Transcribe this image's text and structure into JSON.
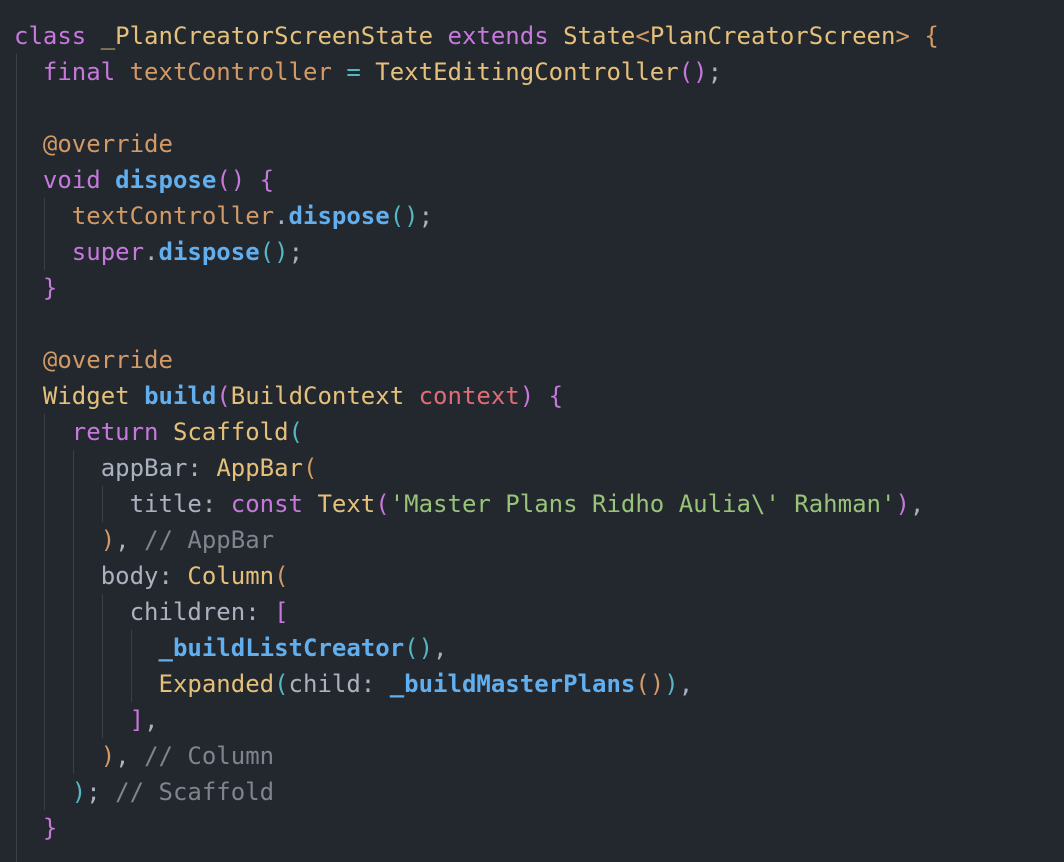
{
  "editor": {
    "lines": [
      [
        [
          "kw",
          "class"
        ],
        [
          "pl",
          " "
        ],
        [
          "cls",
          "_PlanCreatorScreenState"
        ],
        [
          "pl",
          " "
        ],
        [
          "kw",
          "extends"
        ],
        [
          "pl",
          " "
        ],
        [
          "cls",
          "State"
        ],
        [
          "p1",
          "<"
        ],
        [
          "cls",
          "PlanCreatorScreen"
        ],
        [
          "p1",
          ">"
        ],
        [
          "pl",
          " "
        ],
        [
          "p1",
          "{"
        ]
      ],
      [
        [
          "pl",
          "  "
        ],
        [
          "kw",
          "final"
        ],
        [
          "pl",
          " "
        ],
        [
          "var",
          "textController"
        ],
        [
          "pl",
          " "
        ],
        [
          "p3",
          "="
        ],
        [
          "pl",
          " "
        ],
        [
          "cls",
          "TextEditingController"
        ],
        [
          "p2",
          "("
        ],
        [
          "p2",
          ")"
        ],
        [
          "pl",
          ";"
        ]
      ],
      [],
      [
        [
          "pl",
          "  "
        ],
        [
          "ann",
          "@override"
        ]
      ],
      [
        [
          "pl",
          "  "
        ],
        [
          "kw",
          "void"
        ],
        [
          "pl",
          " "
        ],
        [
          "fn",
          "dispose"
        ],
        [
          "p2",
          "("
        ],
        [
          "p2",
          ")"
        ],
        [
          "pl",
          " "
        ],
        [
          "p2",
          "{"
        ]
      ],
      [
        [
          "pl",
          "    "
        ],
        [
          "var",
          "textController"
        ],
        [
          "pl",
          "."
        ],
        [
          "fn",
          "dispose"
        ],
        [
          "p3",
          "("
        ],
        [
          "p3",
          ")"
        ],
        [
          "pl",
          ";"
        ]
      ],
      [
        [
          "pl",
          "    "
        ],
        [
          "kw",
          "super"
        ],
        [
          "pl",
          "."
        ],
        [
          "fn",
          "dispose"
        ],
        [
          "p3",
          "("
        ],
        [
          "p3",
          ")"
        ],
        [
          "pl",
          ";"
        ]
      ],
      [
        [
          "pl",
          "  "
        ],
        [
          "p2",
          "}"
        ]
      ],
      [],
      [
        [
          "pl",
          "  "
        ],
        [
          "ann",
          "@override"
        ]
      ],
      [
        [
          "pl",
          "  "
        ],
        [
          "cls",
          "Widget"
        ],
        [
          "pl",
          " "
        ],
        [
          "fn",
          "build"
        ],
        [
          "p2",
          "("
        ],
        [
          "cls",
          "BuildContext"
        ],
        [
          "pl",
          " "
        ],
        [
          "param",
          "context"
        ],
        [
          "p2",
          ")"
        ],
        [
          "pl",
          " "
        ],
        [
          "p2",
          "{"
        ]
      ],
      [
        [
          "pl",
          "    "
        ],
        [
          "kw",
          "return"
        ],
        [
          "pl",
          " "
        ],
        [
          "cls",
          "Scaffold"
        ],
        [
          "p3",
          "("
        ]
      ],
      [
        [
          "pl",
          "      "
        ],
        [
          "prop",
          "appBar"
        ],
        [
          "pl",
          ": "
        ],
        [
          "cls",
          "AppBar"
        ],
        [
          "p1",
          "("
        ]
      ],
      [
        [
          "pl",
          "        "
        ],
        [
          "prop",
          "title"
        ],
        [
          "pl",
          ": "
        ],
        [
          "kw",
          "const"
        ],
        [
          "pl",
          " "
        ],
        [
          "cls",
          "Text"
        ],
        [
          "p2",
          "("
        ],
        [
          "str",
          "'Master Plans Ridho Aulia\\' Rahman'"
        ],
        [
          "p2",
          ")"
        ],
        [
          "pl",
          ","
        ]
      ],
      [
        [
          "pl",
          "      "
        ],
        [
          "p1",
          ")"
        ],
        [
          "pl",
          ", "
        ],
        [
          "cmt",
          "// AppBar"
        ]
      ],
      [
        [
          "pl",
          "      "
        ],
        [
          "prop",
          "body"
        ],
        [
          "pl",
          ": "
        ],
        [
          "cls",
          "Column"
        ],
        [
          "p1",
          "("
        ]
      ],
      [
        [
          "pl",
          "        "
        ],
        [
          "prop",
          "children"
        ],
        [
          "pl",
          ": "
        ],
        [
          "p2",
          "["
        ]
      ],
      [
        [
          "pl",
          "          "
        ],
        [
          "fn",
          "_buildListCreator"
        ],
        [
          "p3",
          "("
        ],
        [
          "p3",
          ")"
        ],
        [
          "pl",
          ","
        ]
      ],
      [
        [
          "pl",
          "          "
        ],
        [
          "cls",
          "Expanded"
        ],
        [
          "p3",
          "("
        ],
        [
          "prop",
          "child"
        ],
        [
          "pl",
          ": "
        ],
        [
          "fn",
          "_buildMasterPlans"
        ],
        [
          "p1",
          "("
        ],
        [
          "p1",
          ")"
        ],
        [
          "p3",
          ")"
        ],
        [
          "pl",
          ","
        ]
      ],
      [
        [
          "pl",
          "        "
        ],
        [
          "p2",
          "]"
        ],
        [
          "pl",
          ","
        ]
      ],
      [
        [
          "pl",
          "      "
        ],
        [
          "p1",
          ")"
        ],
        [
          "pl",
          ", "
        ],
        [
          "cmt",
          "// Column"
        ]
      ],
      [
        [
          "pl",
          "    "
        ],
        [
          "p3",
          ")"
        ],
        [
          "pl",
          "; "
        ],
        [
          "cmt",
          "// Scaffold"
        ]
      ],
      [
        [
          "pl",
          "  "
        ],
        [
          "p2",
          "}"
        ]
      ]
    ]
  }
}
